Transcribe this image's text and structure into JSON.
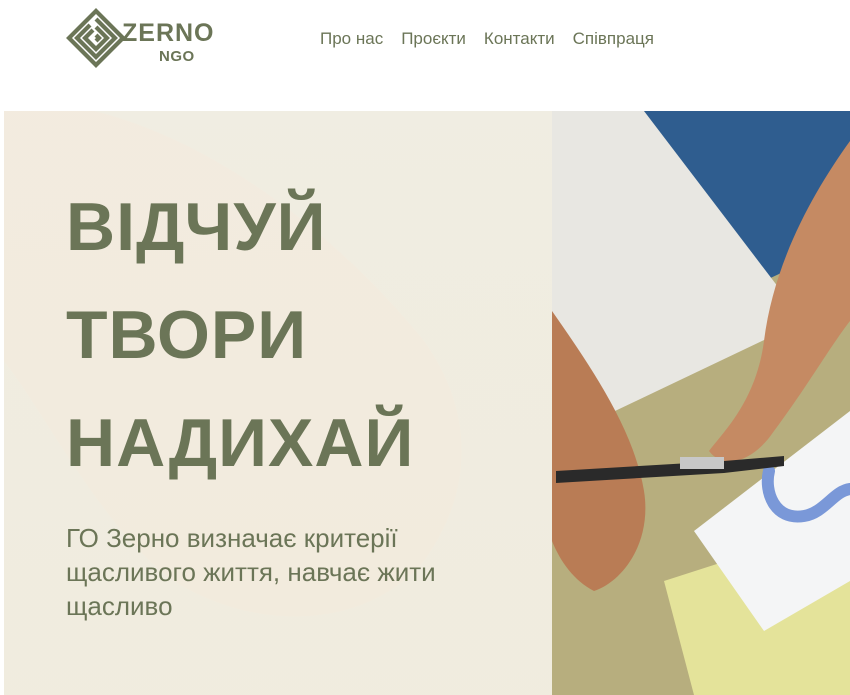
{
  "header": {
    "logo": {
      "word": "ZERNO",
      "sub": "NGO"
    },
    "nav": [
      "Про нас",
      "Проєкти",
      "Контакти",
      "Співпраця"
    ]
  },
  "hero": {
    "title_lines": [
      "ВІДЧУЙ",
      "ТВОРИ",
      "НАДИХАЙ"
    ],
    "subtitle": "ГО Зерно визначає критерії щасливого життя, навчає жити щасливо"
  },
  "colors": {
    "brand_olive": "#6b7557",
    "overlay_cream": "#f6f2e7"
  },
  "icons": {
    "logo_mark": "spiral-icon"
  }
}
